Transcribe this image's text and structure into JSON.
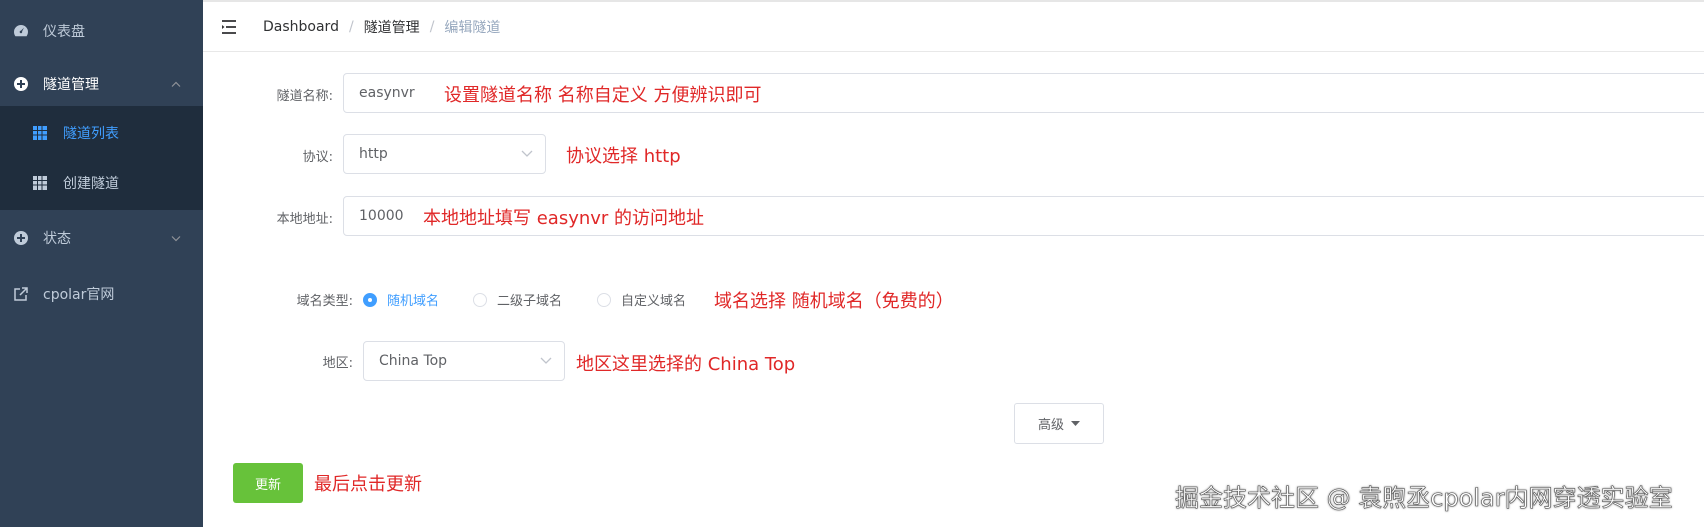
{
  "sidebar": {
    "dashboard_label": "仪表盘",
    "tunnel_mgmt_label": "隧道管理",
    "tunnel_list_label": "隧道列表",
    "create_tunnel_label": "创建隧道",
    "status_label": "状态",
    "cpolar_site_label": "cpolar官网"
  },
  "breadcrumb": {
    "item1": "Dashboard",
    "item2": "隧道管理",
    "item3": "编辑隧道",
    "sep": "/"
  },
  "form": {
    "name_label": "隧道名称:",
    "name_value": "easynvr",
    "protocol_label": "协议:",
    "protocol_value": "http",
    "local_addr_label": "本地地址:",
    "local_addr_value": "10000",
    "domain_type_label": "域名类型:",
    "domain_options": [
      "随机域名",
      "二级子域名",
      "自定义域名"
    ],
    "region_label": "地区:",
    "region_value": "China Top",
    "advanced_label": "高级",
    "update_label": "更新"
  },
  "annotations": {
    "name": "设置隧道名称 名称自定义 方便辨识即可",
    "protocol": "协议选择 http",
    "local_addr": "本地地址填写 easynvr 的访问地址",
    "domain_type": "域名选择 随机域名（免费的）",
    "region": "地区这里选择的 China Top",
    "update": "最后点击更新"
  },
  "watermark": "掘金技术社区 @ 袁煦丞cpolar内网穿透实验室",
  "colors": {
    "sidebar_bg": "#304156",
    "submenu_bg": "#1f2d3d",
    "active": "#409eff",
    "update_btn": "#67c23a",
    "annotation": "#e02828"
  }
}
